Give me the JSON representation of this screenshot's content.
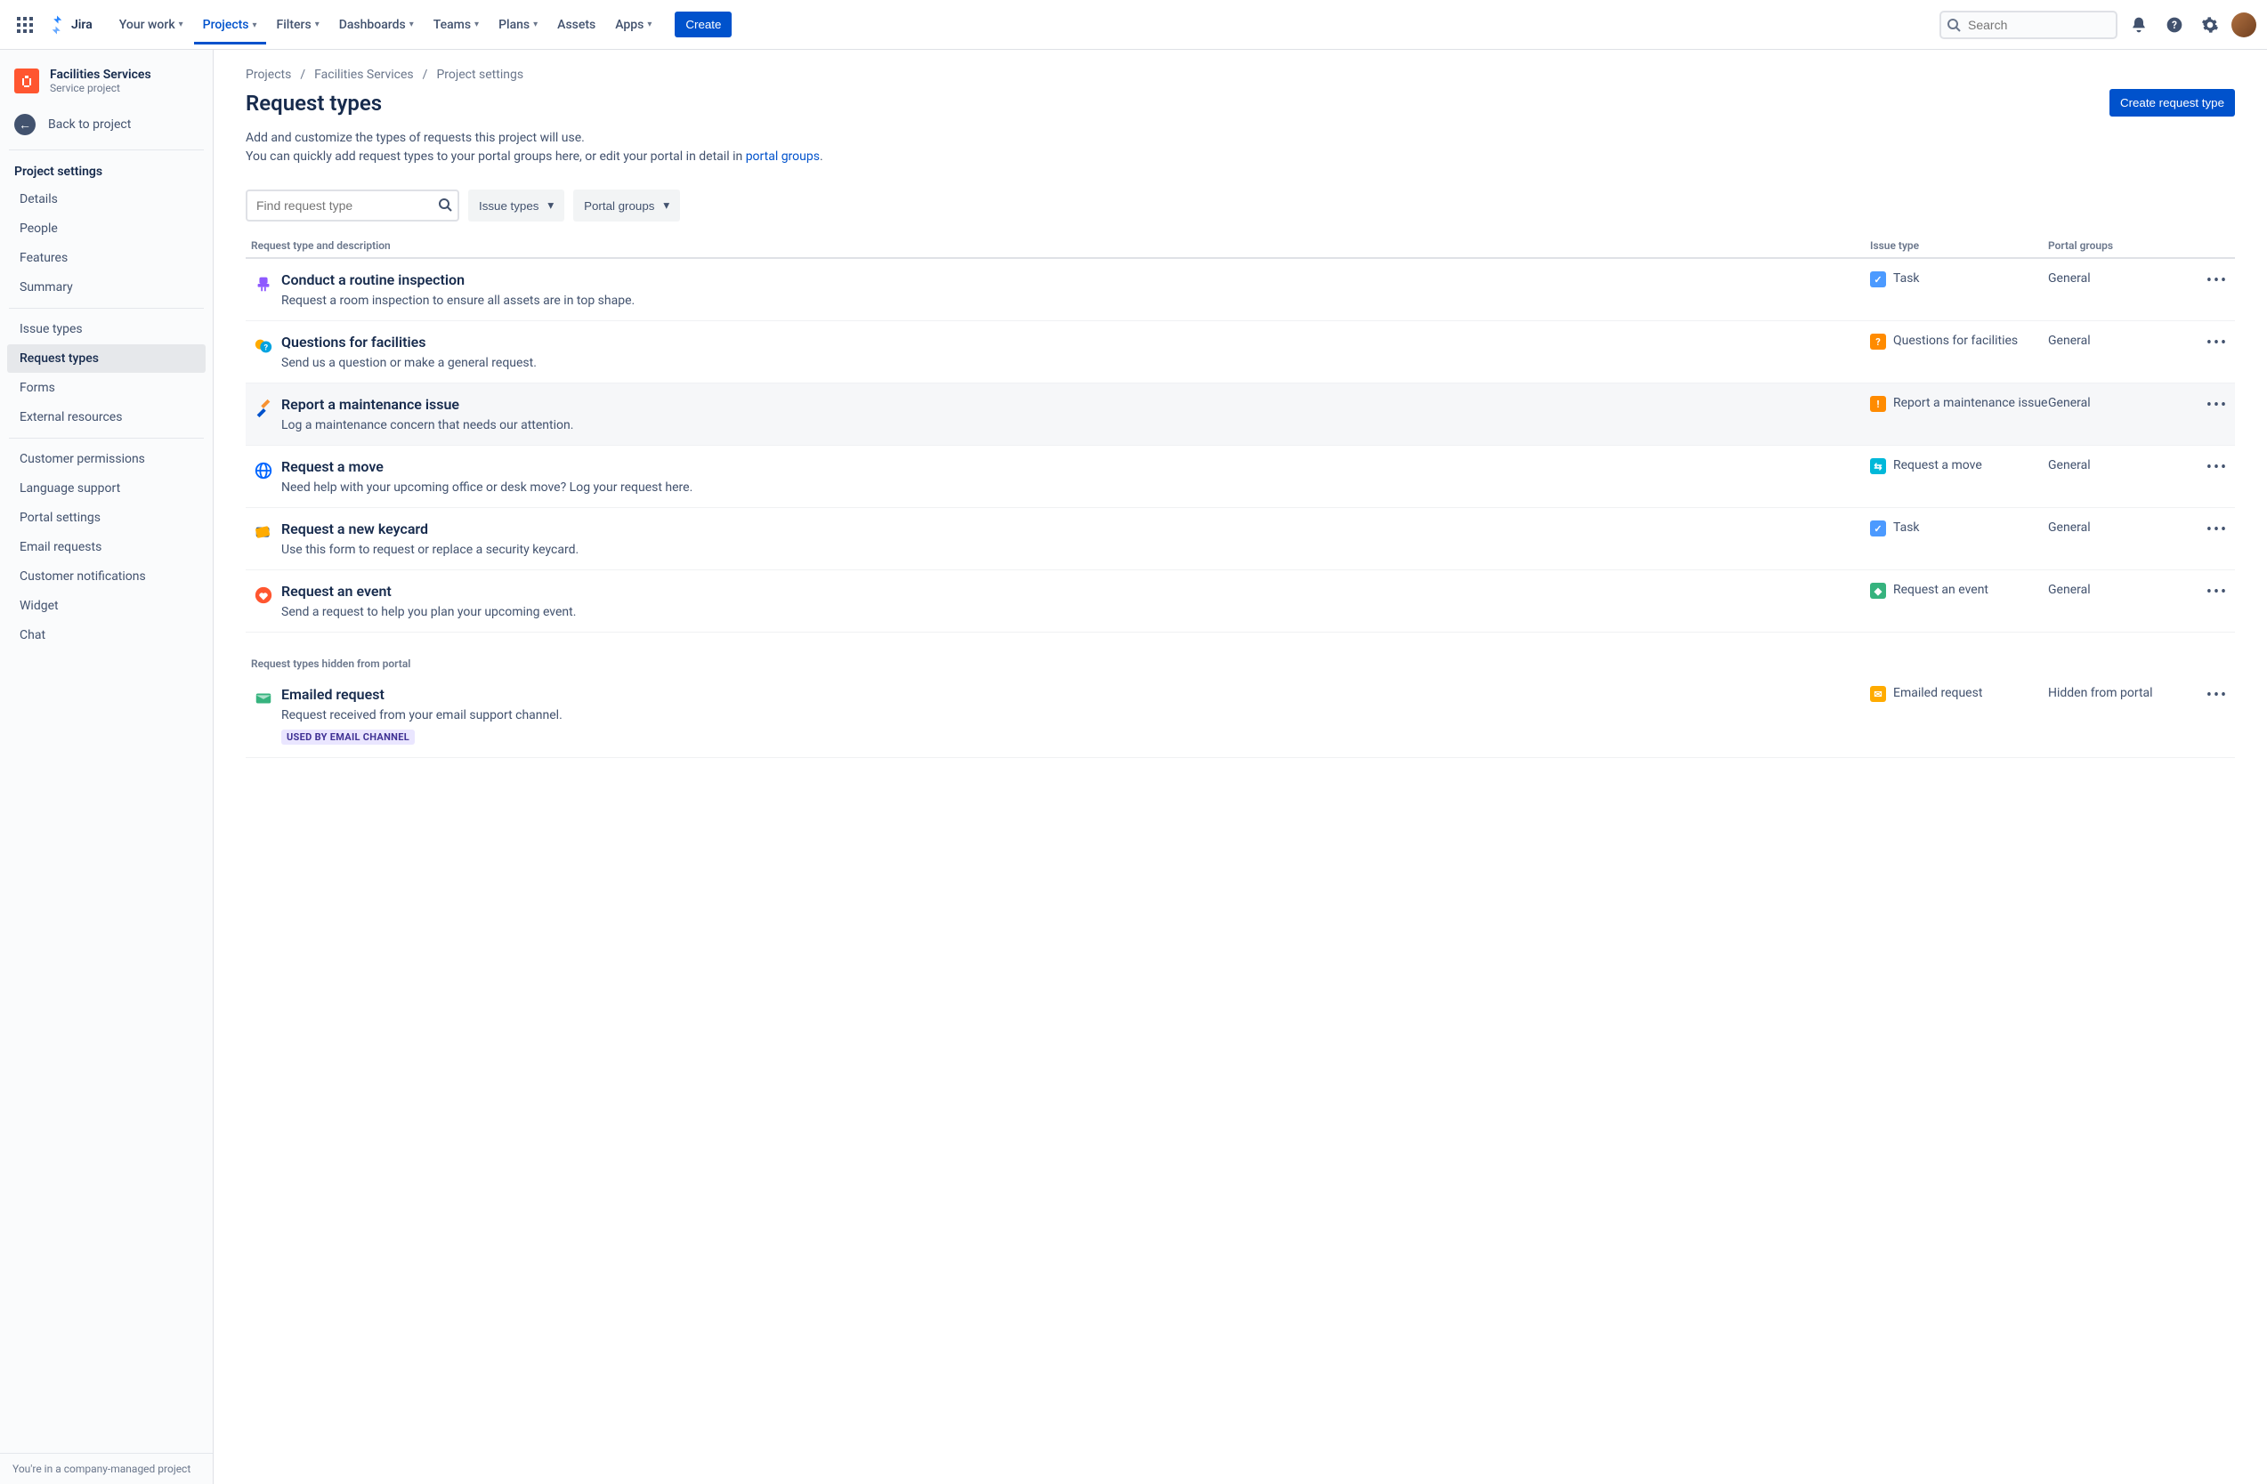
{
  "nav": {
    "product": "Jira",
    "items": [
      "Your work",
      "Projects",
      "Filters",
      "Dashboards",
      "Teams",
      "Plans",
      "Assets",
      "Apps"
    ],
    "activeIndex": 1,
    "createLabel": "Create",
    "searchPlaceholder": "Search"
  },
  "project": {
    "name": "Facilities Services",
    "type": "Service project"
  },
  "sidebar": {
    "back": "Back to project",
    "settingsTitle": "Project settings",
    "group1": [
      "Details",
      "People",
      "Features",
      "Summary"
    ],
    "group2": [
      "Issue types",
      "Request types",
      "Forms",
      "External resources"
    ],
    "group2Selected": 1,
    "group3": [
      "Customer permissions",
      "Language support",
      "Portal settings",
      "Email requests",
      "Customer notifications",
      "Widget",
      "Chat"
    ],
    "footer": "You're in a company-managed project"
  },
  "breadcrumb": [
    "Projects",
    "Facilities Services",
    "Project settings"
  ],
  "page": {
    "title": "Request types",
    "createBtn": "Create request type",
    "descLine1": "Add and customize the types of requests this project will use.",
    "descLine2a": "You can quickly add request types to your portal groups here, or edit your portal in detail in ",
    "descLink": "portal groups",
    "descLine2b": "."
  },
  "filters": {
    "findPlaceholder": "Find request type",
    "issueTypes": "Issue types",
    "portalGroups": "Portal groups"
  },
  "columns": {
    "c1": "Request type and description",
    "c2": "Issue type",
    "c3": "Portal groups"
  },
  "rows": [
    {
      "name": "Conduct a routine inspection",
      "desc": "Request a room inspection to ensure all assets are in top shape.",
      "issueType": "Task",
      "portal": "General",
      "iconColor": "#8E59FF",
      "iconGlyph": "seat",
      "itColor": "#4C9AFF",
      "itGlyph": "✓"
    },
    {
      "name": "Questions for facilities",
      "desc": "Send us a question or make a general request.",
      "issueType": "Questions for facilities",
      "portal": "General",
      "iconColor": "#00A3E0",
      "iconGlyph": "help",
      "itColor": "#FF8B00",
      "itGlyph": "?"
    },
    {
      "name": "Report a maintenance issue",
      "desc": "Log a maintenance concern that needs our attention.",
      "issueType": "Report a maintenance issue",
      "portal": "General",
      "iconColor": "#F79232",
      "iconGlyph": "tools",
      "itColor": "#FF8B00",
      "itGlyph": "!",
      "highlight": true
    },
    {
      "name": "Request a move",
      "desc": "Need help with your upcoming office or desk move? Log your request here.",
      "issueType": "Request a move",
      "portal": "General",
      "iconColor": "#0065FF",
      "iconGlyph": "globe",
      "itColor": "#00B8D9",
      "itGlyph": "⇆"
    },
    {
      "name": "Request a new keycard",
      "desc": "Use this form to request or replace a security keycard.",
      "issueType": "Task",
      "portal": "General",
      "iconColor": "#0747A6",
      "iconGlyph": "card",
      "itColor": "#4C9AFF",
      "itGlyph": "✓"
    },
    {
      "name": "Request an event",
      "desc": "Send a request to help you plan your upcoming event.",
      "issueType": "Request an event",
      "portal": "General",
      "iconColor": "#FF5630",
      "iconGlyph": "heart",
      "itColor": "#36B37E",
      "itGlyph": "◆"
    }
  ],
  "hiddenSectionLabel": "Request types hidden from portal",
  "hiddenRows": [
    {
      "name": "Emailed request",
      "desc": "Request received from your email support channel.",
      "issueType": "Emailed request",
      "portal": "Hidden from portal",
      "iconColor": "#36B37E",
      "iconGlyph": "mail",
      "itColor": "#FFAB00",
      "itGlyph": "✉",
      "tag": "USED BY EMAIL CHANNEL"
    }
  ]
}
